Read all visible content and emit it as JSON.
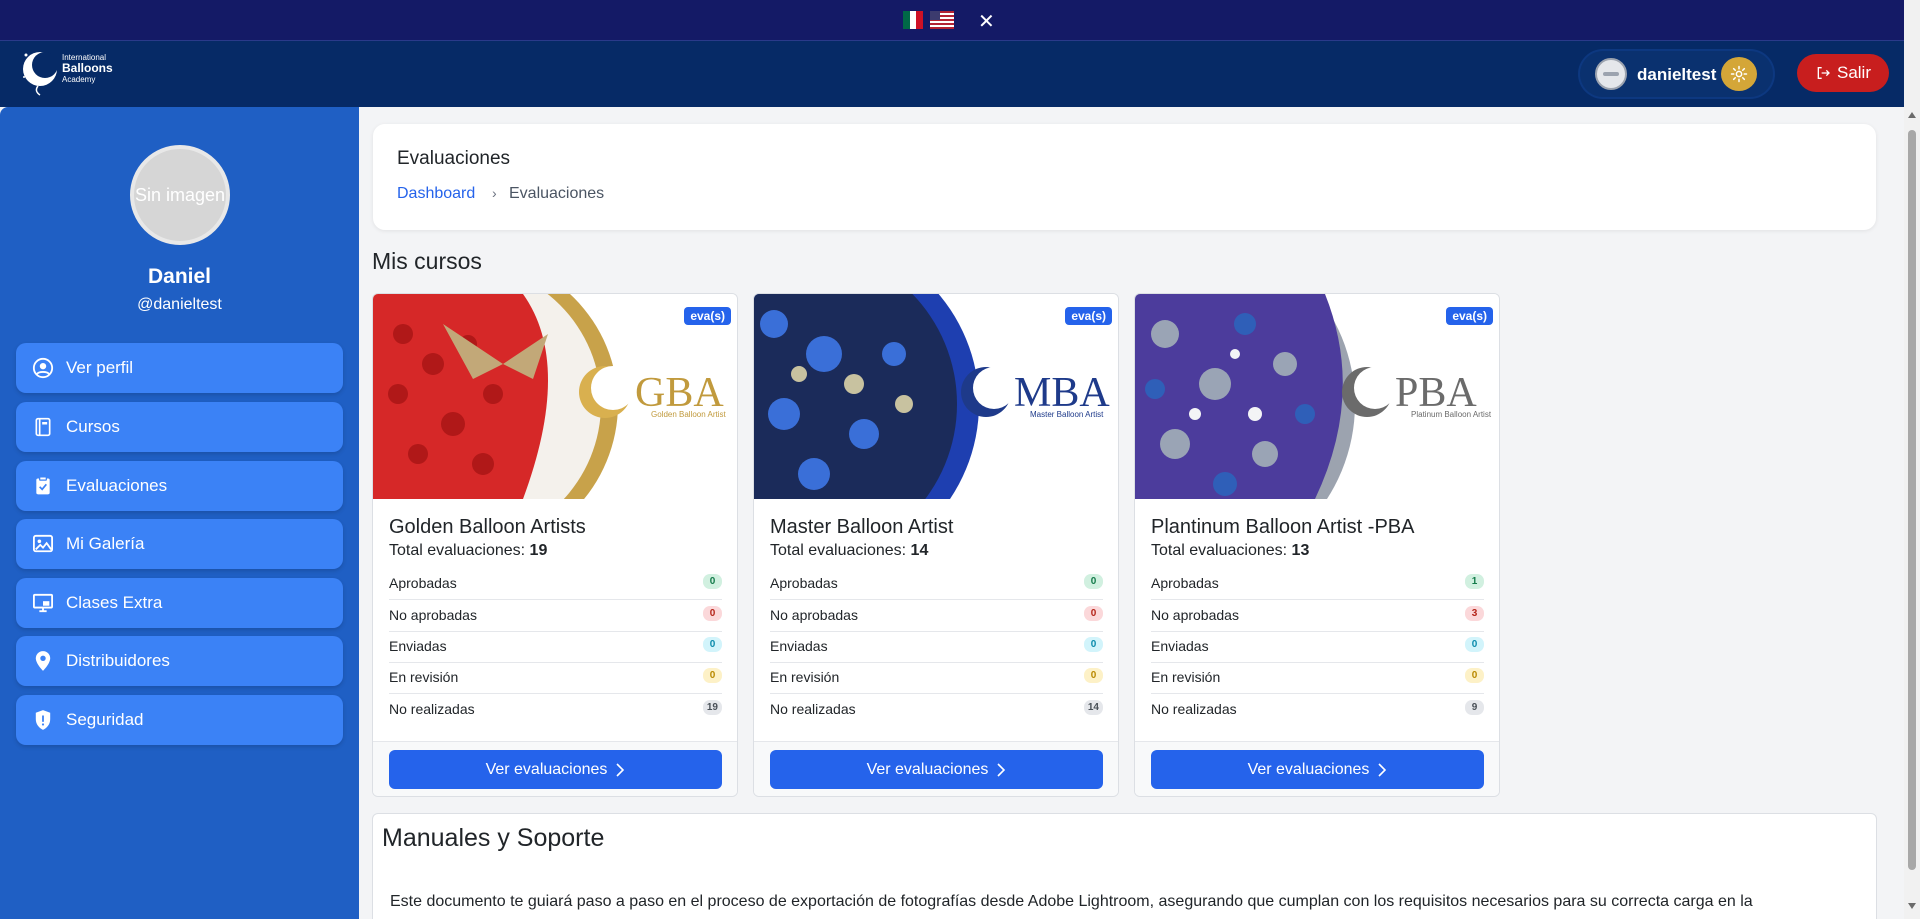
{
  "lang_bar": {
    "close_label": "✕"
  },
  "header": {
    "logo": {
      "line1": "International",
      "line2": "Balloons",
      "line3": "Academy"
    },
    "username": "danieltest",
    "logout_label": "Salir"
  },
  "sidebar": {
    "avatar_placeholder": "Sin imagen",
    "name": "Daniel",
    "handle": "@danieltest",
    "items": [
      {
        "label": "Ver perfil",
        "icon": "user-circle-icon"
      },
      {
        "label": "Cursos",
        "icon": "book-icon"
      },
      {
        "label": "Evaluaciones",
        "icon": "clipboard-icon"
      },
      {
        "label": "Mi Galería",
        "icon": "image-icon"
      },
      {
        "label": "Clases Extra",
        "icon": "monitor-icon"
      },
      {
        "label": "Distribuidores",
        "icon": "map-pin-icon"
      },
      {
        "label": "Seguridad",
        "icon": "shield-icon"
      }
    ]
  },
  "page": {
    "title": "Evaluaciones",
    "breadcrumb": {
      "home": "Dashboard",
      "separator": "›",
      "current": "Evaluaciones"
    },
    "section_title": "Mis cursos"
  },
  "courses": [
    {
      "badge": "eva(s)",
      "banner_brand": "GBA",
      "banner_sub": "Golden Balloon Artist",
      "title": "Golden Balloon Artists",
      "total_label": "Total evaluaciones:",
      "total": "19",
      "stats": [
        {
          "label": "Aprobadas",
          "value": "0"
        },
        {
          "label": "No aprobadas",
          "value": "0"
        },
        {
          "label": "Enviadas",
          "value": "0"
        },
        {
          "label": "En revisión",
          "value": "0"
        },
        {
          "label": "No realizadas",
          "value": "19"
        }
      ],
      "button": "Ver evaluaciones"
    },
    {
      "badge": "eva(s)",
      "banner_brand": "MBA",
      "banner_sub": "Master Balloon Artist",
      "title": "Master Balloon Artist",
      "total_label": "Total evaluaciones:",
      "total": "14",
      "stats": [
        {
          "label": "Aprobadas",
          "value": "0"
        },
        {
          "label": "No aprobadas",
          "value": "0"
        },
        {
          "label": "Enviadas",
          "value": "0"
        },
        {
          "label": "En revisión",
          "value": "0"
        },
        {
          "label": "No realizadas",
          "value": "14"
        }
      ],
      "button": "Ver evaluaciones"
    },
    {
      "badge": "eva(s)",
      "banner_brand": "PBA",
      "banner_sub": "Platinum Balloon Artist",
      "title": "Plantinum Balloon Artist -PBA",
      "total_label": "Total evaluaciones:",
      "total": "13",
      "stats": [
        {
          "label": "Aprobadas",
          "value": "1"
        },
        {
          "label": "No aprobadas",
          "value": "3"
        },
        {
          "label": "Enviadas",
          "value": "0"
        },
        {
          "label": "En revisión",
          "value": "0"
        },
        {
          "label": "No realizadas",
          "value": "9"
        }
      ],
      "button": "Ver evaluaciones"
    }
  ],
  "manual": {
    "title": "Manuales y Soporte",
    "text": "Este documento te guiará paso a paso en el proceso de exportación de fotografías desde Adobe Lightroom, asegurando que cumplan con los requisitos necesarios para su correcta carga en la"
  },
  "colors": {
    "header": "#062a66",
    "lang_bar": "#141a66",
    "sidebar": "#1f5fc4",
    "nav_item": "#3b82f6",
    "primary_button": "#2563eb",
    "logout": "#c81e1e",
    "gold": "#d4a638"
  }
}
